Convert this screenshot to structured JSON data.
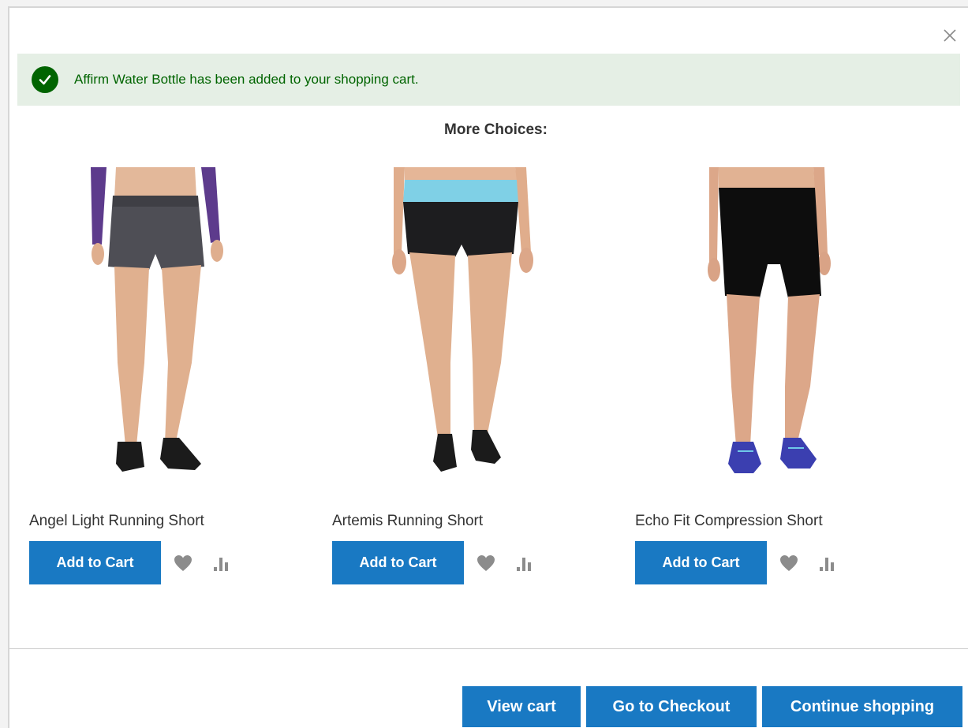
{
  "message": {
    "text": "Affirm Water Bottle has been added to your shopping cart."
  },
  "more_choices": {
    "title": "More Choices:"
  },
  "products": [
    {
      "name": "Angel Light Running Short",
      "add_label": "Add to Cart"
    },
    {
      "name": "Artemis Running Short",
      "add_label": "Add to Cart"
    },
    {
      "name": "Echo Fit Compression Short",
      "add_label": "Add to Cart"
    }
  ],
  "footer": {
    "view_cart": "View cart",
    "checkout": "Go to Checkout",
    "continue": "Continue shopping"
  },
  "colors": {
    "primary_button": "#1979c3",
    "success_bg": "#e5efe5",
    "success_text": "#006400"
  },
  "icons": [
    "close-icon",
    "check-circle-icon",
    "heart-icon",
    "compare-icon"
  ]
}
